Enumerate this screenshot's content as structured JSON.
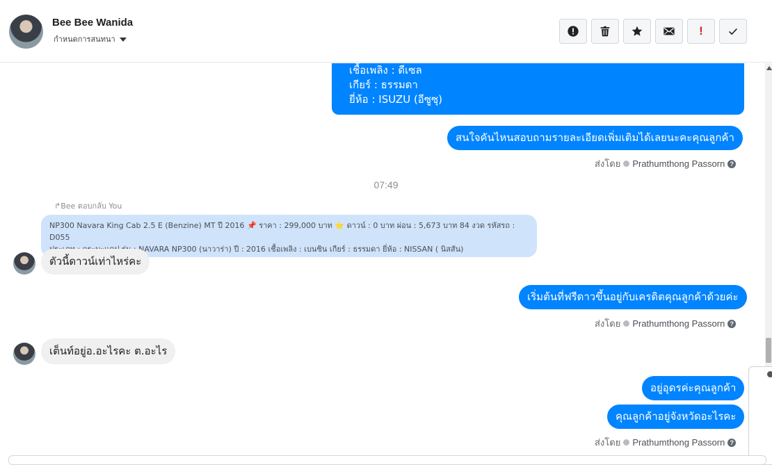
{
  "header": {
    "name": "Bee Bee Wanida",
    "subtitle": "กำหนดการสนทนา",
    "actions": [
      "alert",
      "delete",
      "star",
      "mail",
      "important",
      "done"
    ],
    "important_glyph": "!"
  },
  "thread": {
    "card_lines": [
      "เชื้อเพลิง : ดีเซล",
      "เกียร์ : ธรรมดา",
      "ยี่ห้อ : ISUZU (อีซูซุ)"
    ],
    "out_1": "สนใจคันไหนสอบถามรายละเอียดเพิ่มเติมได้เลยนะคะคุณลูกค้า",
    "sent_by_label": "ส่งโดย",
    "sent_by_name": "Prathumthong Passorn",
    "help_glyph": "?",
    "time": "07:49",
    "reply_note": "Bee ตอบกลับ You",
    "quoted_line1": "NP300 Navara King Cab 2.5 E (Benzine) MT ปี 2016 📌 ราคา : 299,000 บาท ⭐ ดาวน์ : 0 บาท ผ่อน : 5,673 บาท 84 งวด รหัสรถ : D055",
    "quoted_line2": "ประเภท : กระบะแคป รุ่น : NAVARA NP300 (นาวาร่า) ปี : 2016 เชื้อเพลิง : เบนซิน เกียร์ : ธรรมดา ยี่ห้อ : NISSAN ( นิสสัน)",
    "in_1": "ตัวนี้ดาวน์เท่าไหร่คะ",
    "out_2": "เริ่มต้นที่ฟรีดาวขึ้นอยู่กับเครดิตคุณลูกค้าด้วยค่ะ",
    "in_2": "เต็นท์อยู่อ.อะไรคะ ต.อะไร",
    "out_3": "อยู่อุดรค่ะคุณลูกค้า",
    "out_4": "คุณลูกค้าอยู่จังหวัดอะไรคะ"
  },
  "colors": {
    "outgoing": "#0084ff",
    "incoming": "#f0f0f0",
    "quoted": "#cfe3fb",
    "important": "#e0201b"
  }
}
